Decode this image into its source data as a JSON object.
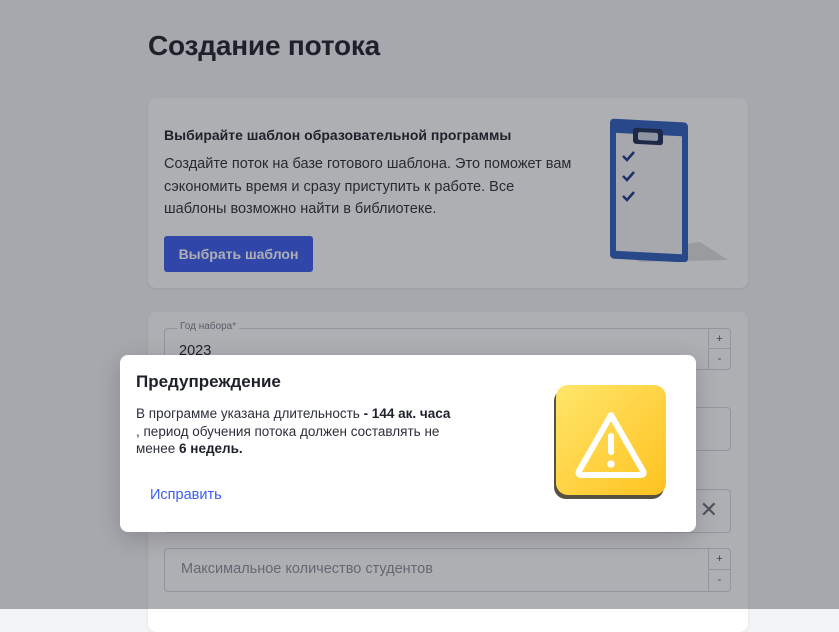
{
  "page": {
    "title": "Создание потока"
  },
  "template_card": {
    "heading": "Выбирайте шаблон образовательной программы",
    "description": "Создайте поток на базе готового шаблона. Это поможет вам сэкономить время и сразу приступить к работе. Все шаблоны возможно найти в библиотеке.",
    "button_label": "Выбрать шаблон"
  },
  "form": {
    "year": {
      "label": "Год набора*",
      "value": "2023"
    },
    "max_students": {
      "placeholder": "Максимальное количество студентов"
    },
    "stepper": {
      "plus": "+",
      "minus": "-"
    },
    "clear_symbol": "✕"
  },
  "modal": {
    "title": "Предупреждение",
    "text_part1": "В программе указана длительность",
    "text_bold1": "- 144 ак. часа",
    "text_part2": ", период обучения потока должен составлять не менее",
    "text_bold2": "6 недель.",
    "fix_button": "Исправить"
  },
  "colors": {
    "accent": "#3a5df0",
    "warning_yellow": "#ffd633",
    "clipboard_blue": "#2f5fbf"
  },
  "icons": {
    "illustration": "clipboard-checklist-icon",
    "warning": "warning-triangle-icon"
  }
}
